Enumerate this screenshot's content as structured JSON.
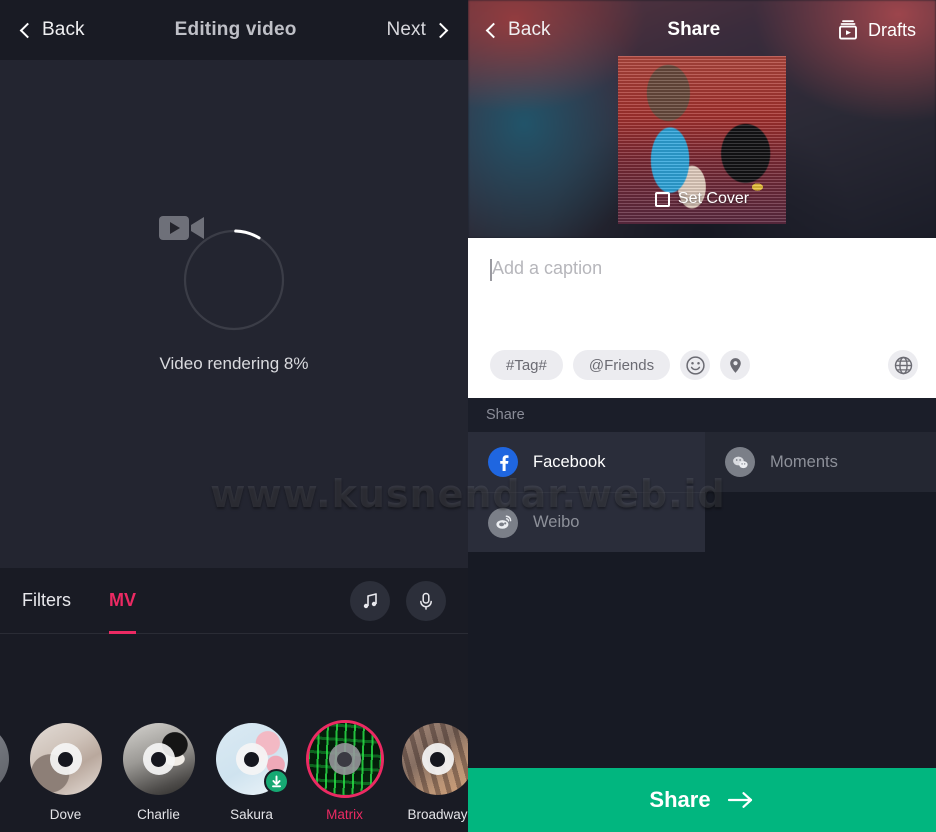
{
  "editor": {
    "back_label": "Back",
    "title": "Editing video",
    "next_label": "Next",
    "render_status": "Video rendering 8%",
    "render_percent": 8,
    "video_icon": "video-camera-icon",
    "tabs": [
      {
        "label": "Filters",
        "active": false
      },
      {
        "label": "MV",
        "active": true
      }
    ],
    "tools": [
      {
        "name": "music-icon",
        "glyph": "music"
      },
      {
        "name": "microphone-icon",
        "glyph": "mic"
      }
    ],
    "accent_color": "#ec2a63",
    "mv_filters": [
      {
        "label": "",
        "art": "art-partial",
        "selected": false,
        "download": false,
        "edge": true
      },
      {
        "label": "Dove",
        "art": "art-dove",
        "selected": false,
        "download": false,
        "edge": false
      },
      {
        "label": "Charlie",
        "art": "art-charlie",
        "selected": false,
        "download": false,
        "edge": false
      },
      {
        "label": "Sakura",
        "art": "art-sakura",
        "selected": false,
        "download": true,
        "edge": false
      },
      {
        "label": "Matrix",
        "art": "art-matrix",
        "selected": true,
        "download": false,
        "edge": false
      },
      {
        "label": "Broadway",
        "art": "art-broadway",
        "selected": false,
        "download": false,
        "edge": false
      }
    ]
  },
  "share": {
    "back_label": "Back",
    "title": "Share",
    "drafts_label": "Drafts",
    "drafts_icon": "drafts-video-icon",
    "set_cover_label": "Set Cover",
    "caption_placeholder": "Add a caption",
    "caption_value": "",
    "chips": [
      {
        "label": "#Tag#",
        "name": "hashtag-chip"
      },
      {
        "label": "@Friends",
        "name": "mention-chip"
      }
    ],
    "icon_buttons": [
      {
        "name": "emoji-icon"
      },
      {
        "name": "location-pin-icon"
      }
    ],
    "privacy_icon": "globe-icon",
    "section_label": "Share",
    "targets": [
      {
        "label": "Facebook",
        "icon": "facebook-icon",
        "enabled": true,
        "column": "left"
      },
      {
        "label": "Moments",
        "icon": "wechat-moments-icon",
        "enabled": false,
        "column": "right"
      },
      {
        "label": "Weibo",
        "icon": "weibo-icon",
        "enabled": false,
        "column": "left"
      }
    ],
    "submit_label": "Share",
    "submit_color": "#01b67f"
  },
  "watermark": {
    "text": "www.kusnendar.web.id"
  }
}
